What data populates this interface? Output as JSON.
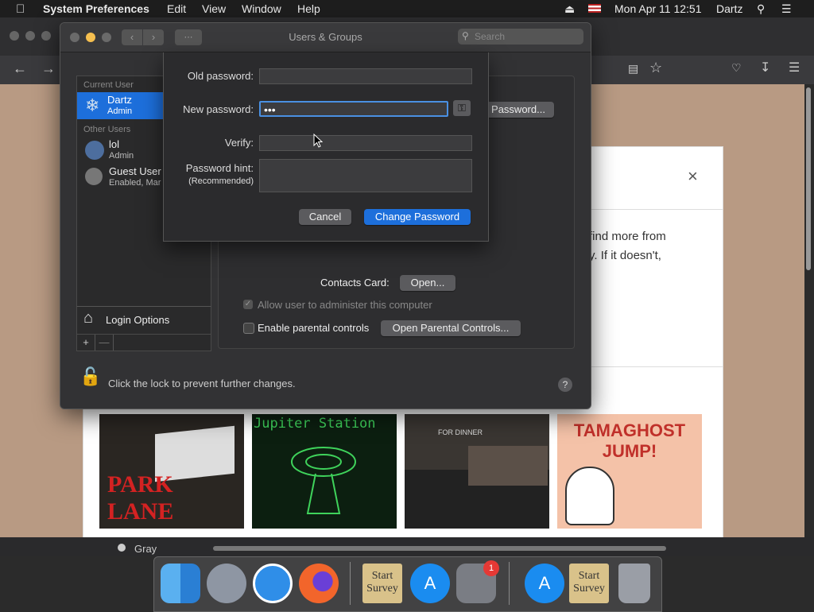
{
  "menubar": {
    "app_name": "System Preferences",
    "menus": [
      "Edit",
      "View",
      "Window",
      "Help"
    ],
    "date_time": "Mon Apr 11  12:51",
    "user": "Dartz"
  },
  "window": {
    "title": "Users & Groups",
    "search_placeholder": "Search"
  },
  "sidebar": {
    "current_user_header": "Current User",
    "current_user": {
      "name": "Dartz",
      "role": "Admin"
    },
    "other_users_header": "Other Users",
    "other_users": [
      {
        "name": "lol",
        "role": "Admin"
      },
      {
        "name": "Guest User",
        "role": "Enabled, Mar"
      }
    ],
    "login_options_label": "Login Options",
    "add_label": "+",
    "remove_label": "—"
  },
  "details": {
    "password_button": "Password...",
    "contacts_card_label": "Contacts Card:",
    "open_button": "Open...",
    "allow_admin_label": "Allow user to administer this computer",
    "parental_controls_label": "Enable parental controls",
    "open_parental_button": "Open Parental Controls..."
  },
  "lock_text": "Click the lock to prevent further changes.",
  "help_label": "?",
  "sheet": {
    "old_password_label": "Old password:",
    "old_password_value": "",
    "new_password_label": "New password:",
    "new_password_value": "•••",
    "verify_label": "Verify:",
    "verify_value": "",
    "hint_label": "Password hint:",
    "hint_sublabel": "(Recommended)",
    "hint_value": "",
    "cancel_button": "Cancel",
    "change_button": "Change Password"
  },
  "background_page": {
    "snippet_line1": "find more from",
    "snippet_line2": "y. If it doesn't,",
    "close_label": "×",
    "thumbnails": [
      "PARK LANE",
      "Jupiter Station",
      "FOR DINNER",
      "TAMAGHOST JUMP!"
    ],
    "status_label": "Gray"
  },
  "dock": {
    "items": [
      "Finder",
      "Launchpad",
      "Safari",
      "Firefox",
      "Start Survey",
      "App Store",
      "System Preferences",
      "App Store",
      "Start Survey",
      "Trash"
    ],
    "badge": "1",
    "survey_label": "Start Survey"
  },
  "colors": {
    "accent": "#1d6fdb",
    "focus_ring": "#4a90e2",
    "page_bg": "#b89a83"
  }
}
